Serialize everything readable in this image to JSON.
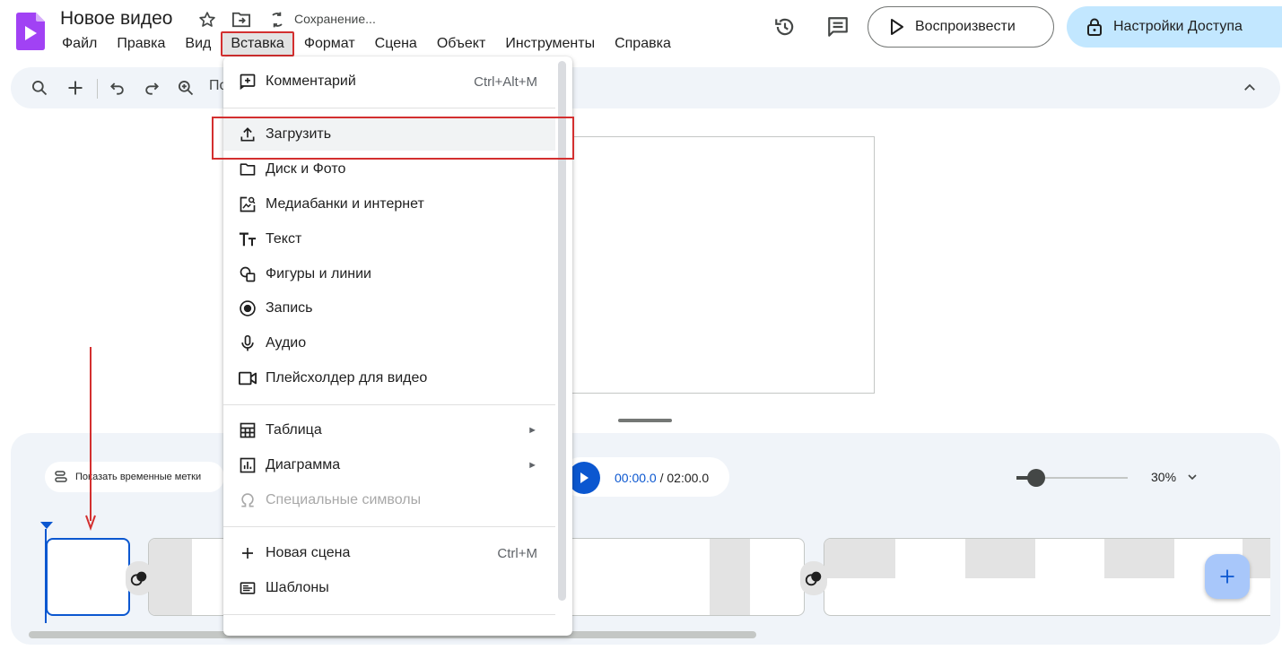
{
  "header": {
    "doc_title": "Новое видео",
    "saving_status": "Сохранение...",
    "play_label": "Воспроизвести",
    "share_label": "Настройки Доступа",
    "icons": [
      "vids-logo-icon",
      "star-icon",
      "move-to-folder-icon",
      "sync-icon",
      "history-icon",
      "comment-icon",
      "play-icon",
      "lock-icon"
    ]
  },
  "menubar": {
    "items": [
      "Файл",
      "Правка",
      "Вид",
      "Вставка",
      "Формат",
      "Сцена",
      "Объект",
      "Инструменты",
      "Справка"
    ],
    "active_item": "Вставка"
  },
  "toolbar": {
    "partial_text": "По",
    "icons": [
      "search-icon",
      "add-icon",
      "undo-icon",
      "redo-icon",
      "zoom-icon",
      "collapse-chevron-icon"
    ]
  },
  "insert_menu": {
    "comment": {
      "label": "Комментарий",
      "shortcut": "Ctrl+Alt+M"
    },
    "upload": {
      "label": "Загрузить"
    },
    "drive_photos": {
      "label": "Диск и Фото"
    },
    "stock_web": {
      "label": "Медиабанки и интернет"
    },
    "text": {
      "label": "Текст"
    },
    "shapes": {
      "label": "Фигуры и линии"
    },
    "record": {
      "label": "Запись"
    },
    "audio": {
      "label": "Аудио"
    },
    "video_placeholder": {
      "label": "Плейсхолдер для видео"
    },
    "table": {
      "label": "Таблица",
      "submenu_arrow": "►"
    },
    "chart": {
      "label": "Диаграмма",
      "submenu_arrow": "►"
    },
    "special_chars": {
      "label": "Специальные символы",
      "disabled": true
    },
    "new_scene": {
      "label": "Новая сцена",
      "shortcut": "Ctrl+M"
    },
    "templates": {
      "label": "Шаблоны"
    }
  },
  "timeline": {
    "show_timestamps_label": "Показать временные метки",
    "current_time": "00:00.0",
    "separator": " / ",
    "duration": "02:00.0",
    "zoom_level": "30%",
    "zoom_fraction": 0.18
  },
  "colors": {
    "accent": "#0b57d0",
    "share_bg": "#c2e7ff",
    "annotation_red": "#d32f2f",
    "panel_bg": "#f0f4f9"
  }
}
